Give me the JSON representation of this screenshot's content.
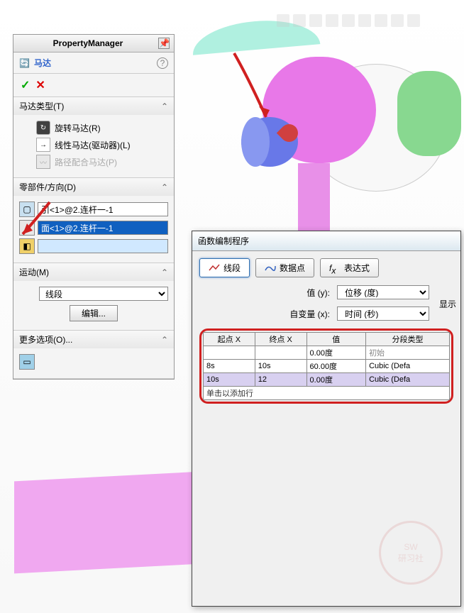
{
  "propertyManager": {
    "headerTitle": "PropertyManager",
    "featureTitle": "马达",
    "sections": {
      "motorType": {
        "title": "马达类型(T)",
        "rotary": "旋转马达(R)",
        "linear": "线性马达(驱动器)(L)",
        "path": "路径配合马达(P)"
      },
      "componentDir": {
        "title": "零部件/方向(D)",
        "field1": "引<1>@2.连杆一-1",
        "field2": "面<1>@2.连杆一-1"
      },
      "motion": {
        "title": "运动(M)",
        "type": "线段",
        "editBtn": "编辑..."
      },
      "moreOptions": {
        "title": "更多选项(O)..."
      }
    }
  },
  "functionEditor": {
    "title": "函数编制程序",
    "tabs": {
      "segment": "线段",
      "dataPoints": "数据点",
      "expression": "表达式"
    },
    "valueLabel": "值 (y):",
    "valueCombo": "位移 (度)",
    "indepLabel": "自变量 (x):",
    "indepCombo": "时间 (秒)",
    "sideLabel": "显示",
    "table": {
      "headers": [
        "起点 X",
        "终点 X",
        "值",
        "分段类型"
      ],
      "rows": [
        {
          "start": "",
          "end": "",
          "val": "0.00度",
          "type": "初始"
        },
        {
          "start": "8s",
          "end": "10s",
          "val": "60.00度",
          "type": "Cubic (Defa"
        },
        {
          "start": "10s",
          "end": "12",
          "val": "0.00度",
          "type": "Cubic (Defa"
        }
      ],
      "addRow": "单击以添加行"
    }
  },
  "stamp": {
    "line1": "SW",
    "line2": "研习社"
  }
}
